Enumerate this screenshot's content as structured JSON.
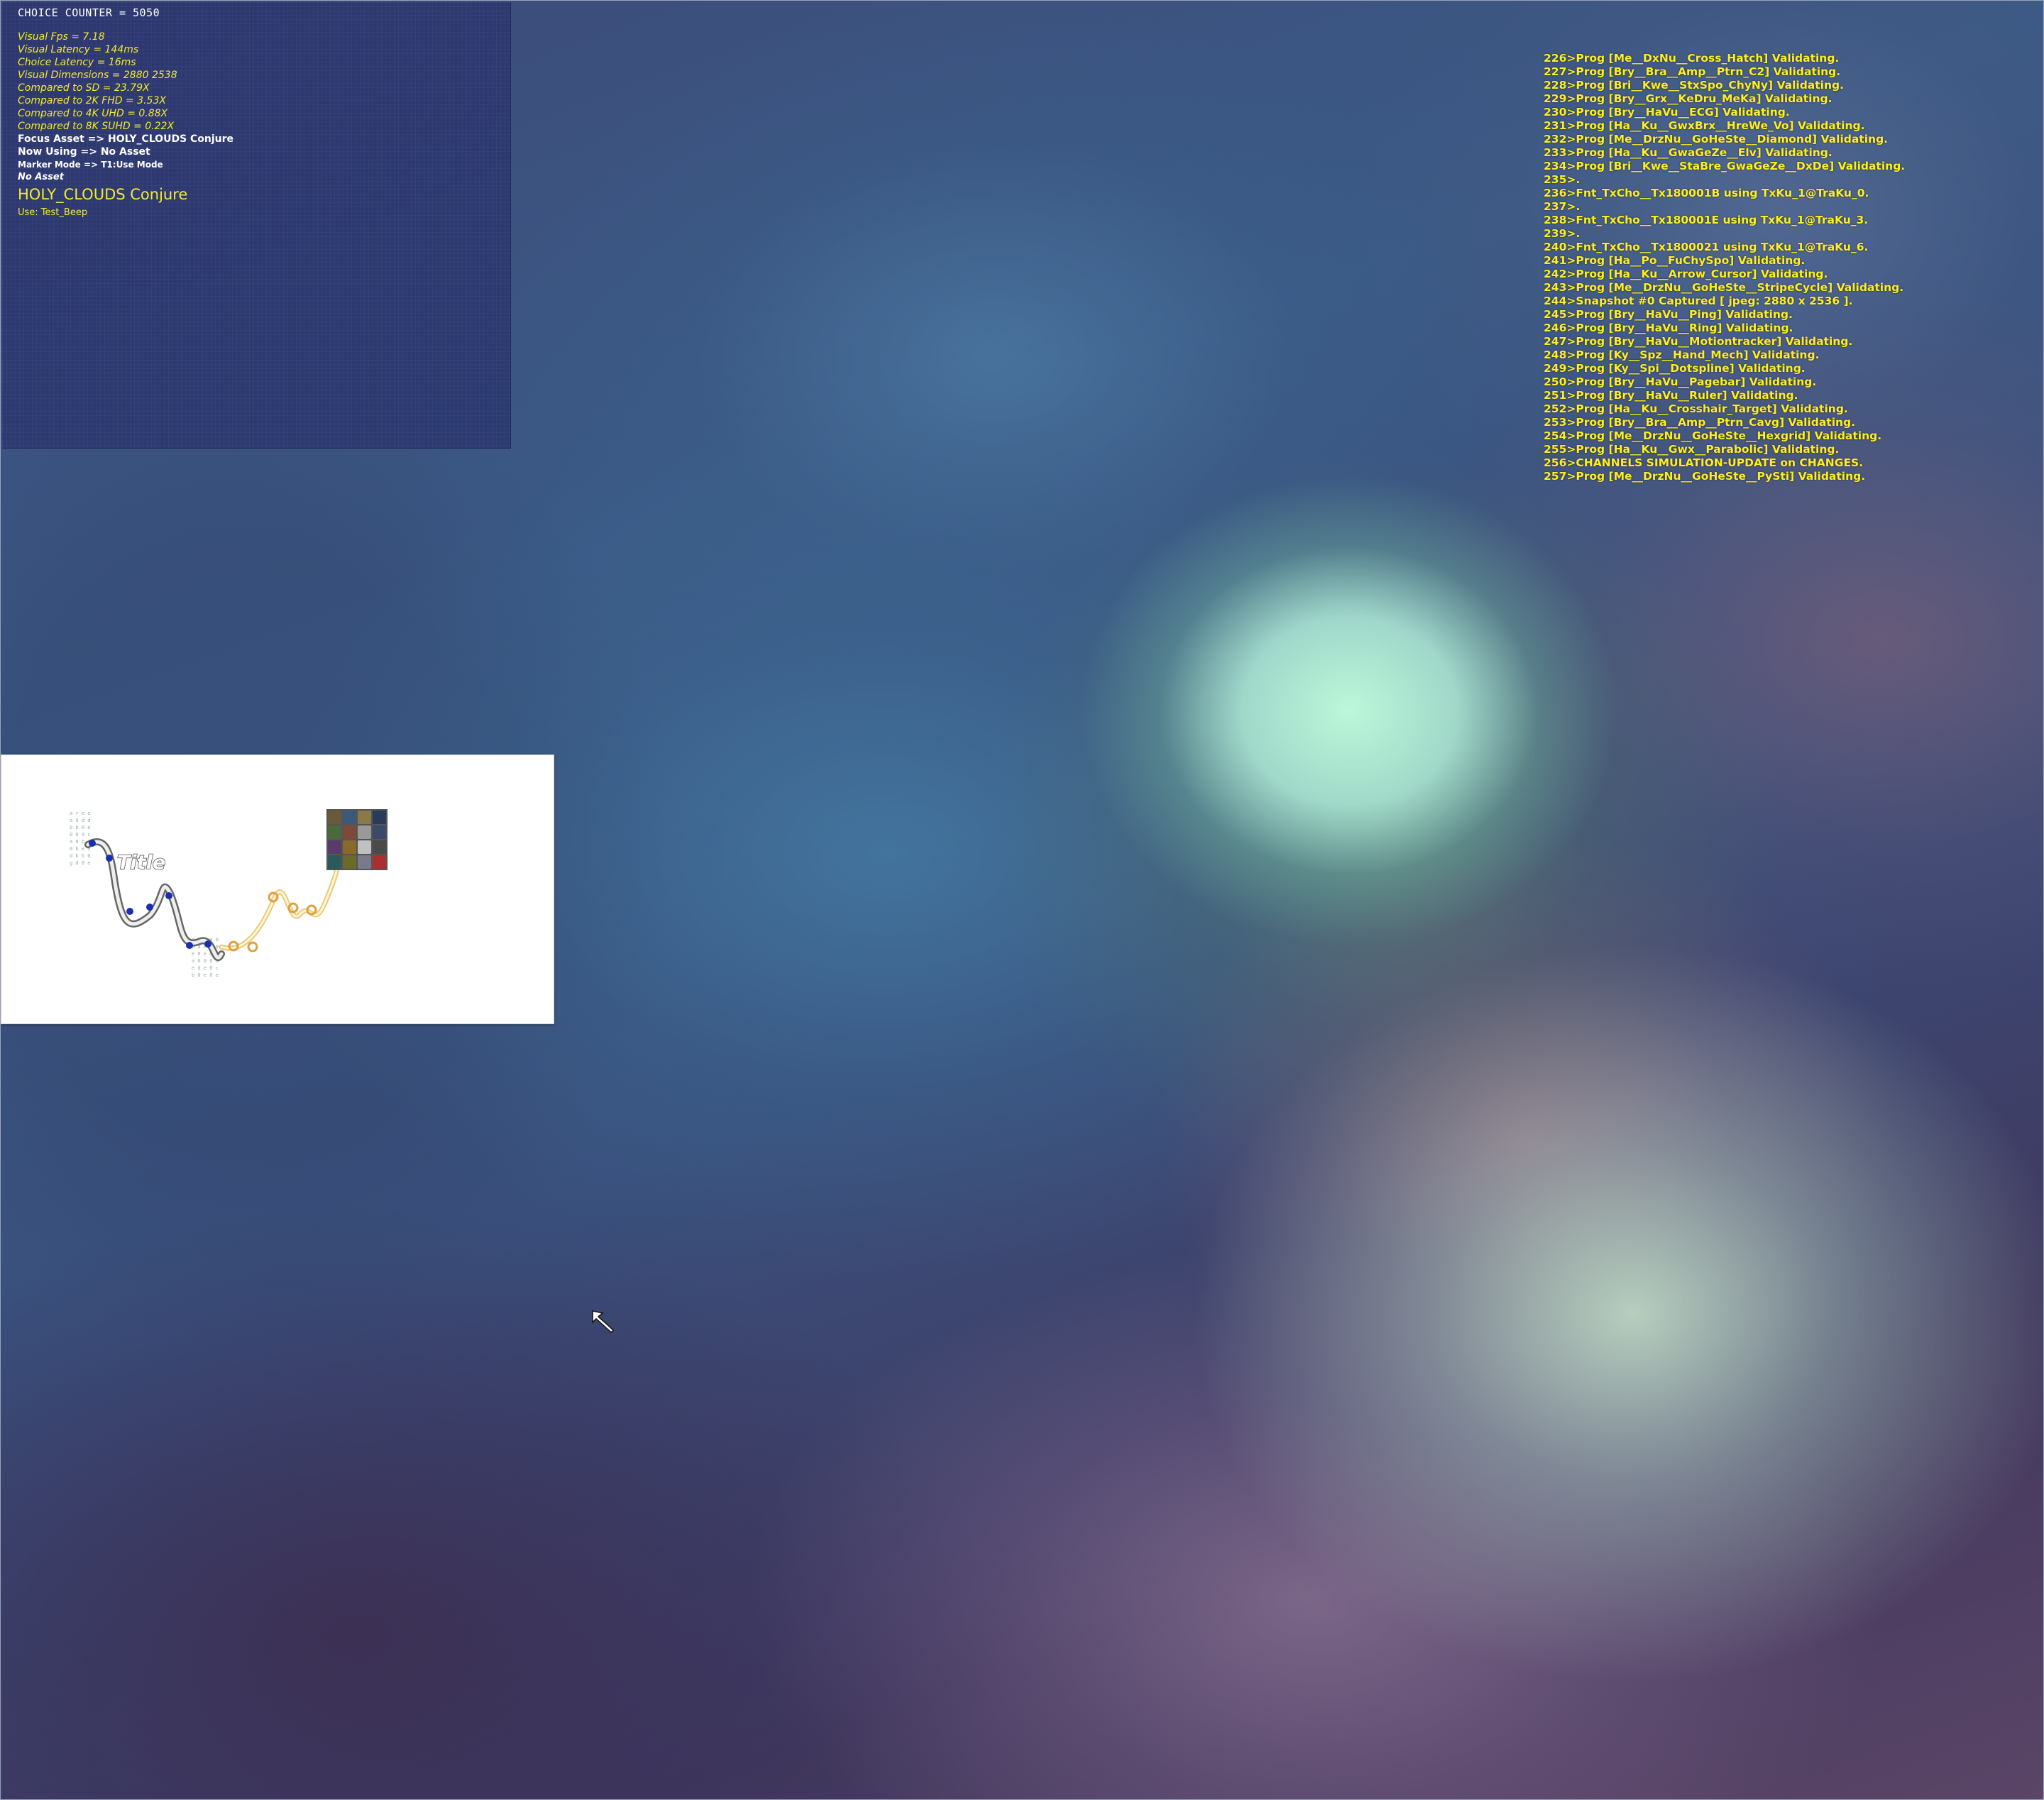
{
  "debug": {
    "choice_counter": "CHOICE COUNTER = 5050",
    "stats": [
      "Visual Fps  = 7.18",
      "Visual Latency = 144ms",
      "Choice Latency = 16ms",
      "Visual Dimensions = 2880 2538",
      "Compared to SD = 23.79X",
      "Compared to 2K FHD = 3.53X",
      "Compared to 4K UHD = 0.88X",
      "Compared to 8K SUHD = 0.22X"
    ],
    "focus_asset": "Focus Asset => HOLY_CLOUDS Conjure",
    "now_using": "Now Using => No Asset",
    "marker_mode": "Marker Mode => T1:Use Mode",
    "no_asset": "No Asset",
    "asset_name": "HOLY_CLOUDS Conjure",
    "use_line": "Use: Test_Beep"
  },
  "log": [
    "226>Prog [Me__DxNu__Cross_Hatch] Validating.",
    "227>Prog [Bry__Bra__Amp__Ptrn_C2] Validating.",
    "228>Prog [Bri__Kwe__StxSpo_ChyNy] Validating.",
    "229>Prog [Bry__Grx__KeDru_MeKa] Validating.",
    "230>Prog [Bry__HaVu__ECG] Validating.",
    "231>Prog [Ha__Ku__GwxBrx__HreWe_Vo] Validating.",
    "232>Prog [Me__DrzNu__GoHeSte__Diamond] Validating.",
    "233>Prog [Ha__Ku__GwaGeZe__Elv] Validating.",
    "234>Prog [Bri__Kwe__StaBre_GwaGeZe__DxDe] Validating.",
    "235>.",
    "236>Fnt_TxCho__Tx180001B using TxKu_1@TraKu_0.",
    "237>.",
    "238>Fnt_TxCho__Tx180001E using TxKu_1@TraKu_3.",
    "239>.",
    "240>Fnt_TxCho__Tx1800021 using TxKu_1@TraKu_6.",
    "241>Prog [Ha__Po__FuChySpo] Validating.",
    "242>Prog [Ha__Ku__Arrow_Cursor] Validating.",
    "243>Prog [Me__DrzNu__GoHeSte__StripeCycle] Validating.",
    "244>Snapshot #0 Captured [ jpeg: 2880 x 2536 ].",
    "245>Prog [Bry__HaVu__Ping] Validating.",
    "246>Prog [Bry__HaVu__Ring] Validating.",
    "247>Prog [Bry__HaVu__Motiontracker] Validating.",
    "248>Prog [Ky__Spz__Hand_Mech] Validating.",
    "249>Prog [Ky__Spi__Dotspline] Validating.",
    "250>Prog [Bry__HaVu__Pagebar] Validating.",
    "251>Prog [Bry__HaVu__Ruler] Validating.",
    "252>Prog [Ha__Ku__Crosshair_Target] Validating.",
    "253>Prog [Bry__Bra__Amp__Ptrn_Cavg] Validating.",
    "254>Prog [Me__DrzNu__GoHeSte__Hexgrid] Validating.",
    "255>Prog [Ha__Ku__Gwx__Parabolic] Validating.",
    "256>CHANNELS SIMULATION-UPDATE on CHANGES.",
    "257>Prog [Me__DrzNu__GoHeSte__PySti] Validating."
  ],
  "widget": {
    "title": "Title",
    "thumb_colors": [
      "#6b5a3a",
      "#3a5a7a",
      "#8a7a4a",
      "#2a3a5a",
      "#4a6a3a",
      "#7a4a3a",
      "#9a9a9a",
      "#3a4a6a",
      "#5a3a6a",
      "#8a6a2a",
      "#c0c0c0",
      "#4a4a4a",
      "#2a5a5a",
      "#6a6a2a",
      "#7a7a8a",
      "#aa3030"
    ]
  },
  "colors": {
    "log_text": "#ffee22",
    "stat_text": "#f5e930",
    "panel_bg": "#2a346e"
  },
  "icons": {
    "cursor": "arrow-cursor-icon"
  }
}
